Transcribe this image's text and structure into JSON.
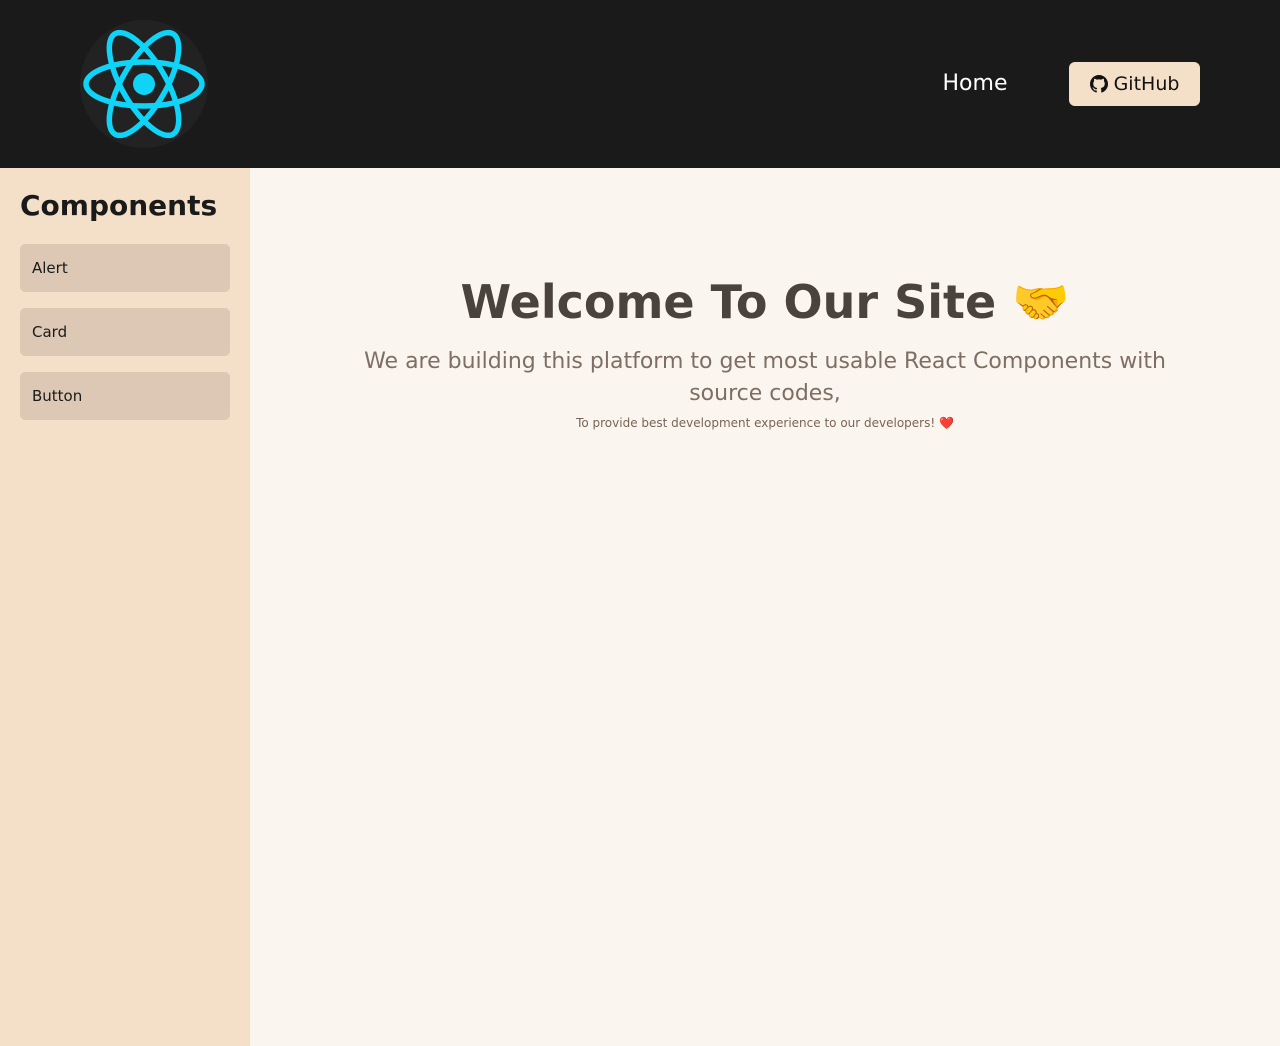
{
  "header": {
    "logo_icon": "react-atom-icon",
    "logo_color": "#0fd4f7",
    "nav": {
      "home_label": "Home",
      "github_label": "GitHub",
      "github_icon": "github-icon"
    }
  },
  "sidebar": {
    "title": "Components",
    "items": [
      {
        "label": "Alert"
      },
      {
        "label": "Card"
      },
      {
        "label": "Button"
      }
    ]
  },
  "main": {
    "title": "Welcome To Our Site 🤝",
    "subtitle": "We are building this platform to get most usable React Components with source codes,",
    "tagline": "To provide best development experience to our developers! ❤️"
  },
  "colors": {
    "header_bg": "#1a1a1a",
    "sidebar_bg": "#f4e0c8",
    "sidebar_item_bg": "#dcc8b4",
    "main_bg": "#faf6ef",
    "button_bg": "#f4e0c8"
  }
}
